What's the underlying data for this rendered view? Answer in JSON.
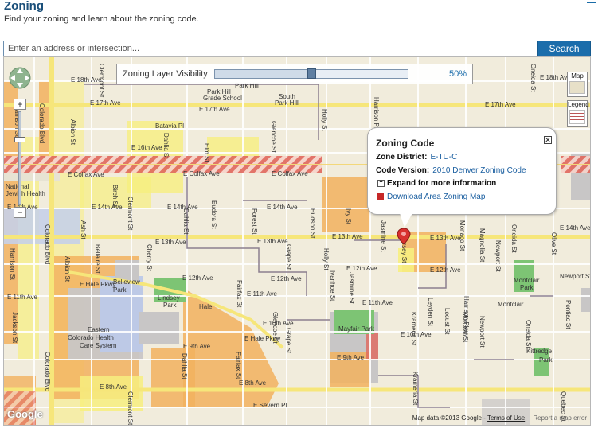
{
  "header": {
    "title": "Zoning",
    "subtitle": "Find your zoning and learn about the zoning code."
  },
  "search": {
    "placeholder": "Enter an address or intersection...",
    "button_label": "Search"
  },
  "layer_slider": {
    "label": "Zoning Layer Visibility",
    "value_label": "50%",
    "value": 0.5
  },
  "map_controls": {
    "map_type_label": "Map",
    "legend_label": "Legend"
  },
  "popup": {
    "title": "Zoning Code",
    "zone_district_label": "Zone District:",
    "zone_district_value": "E-TU-C",
    "code_version_label": "Code Version:",
    "code_version_value": "2010 Denver Zoning Code",
    "expand_label": "Expand for more information",
    "download_label": "Download Area Zoning Map"
  },
  "map_labels": {
    "streets": [
      "E 18th Ave",
      "E 17th Ave",
      "Batavia Pl",
      "E 16th Ave",
      "E Colfax Ave",
      "E 14th Ave",
      "E 13th Ave",
      "E 12th Ave",
      "E 11th Ave",
      "E Hale Pkwy",
      "E 10th Ave",
      "E 9th Ave",
      "E 8th Ave",
      "E Severn Pl",
      "Montclair",
      "Kittredge Park",
      "Mayfair Park",
      "Lindsey Park",
      "Belleview Park",
      "Montclair Park",
      "Hale",
      "Park Hill",
      "Park Hill Grade School",
      "South Park Hill",
      "Colorado Blvd",
      "Albion St",
      "Ash St",
      "Bellaire St",
      "Birch St",
      "Clermont St",
      "Cherry St",
      "Dahlia St",
      "Elm St",
      "Eudora St",
      "Fairfax St",
      "Forest St",
      "Glencoe St",
      "Grape St",
      "Holly St",
      "Hudson St",
      "Ivanhoe St",
      "Ivy St",
      "Jasmine St",
      "Jersey St",
      "Krameria St",
      "Kearney St",
      "Leyden St",
      "Locust St",
      "Magnolia St",
      "Monaco St",
      "Newport St",
      "Oneida St",
      "Olive St",
      "Pontiac St",
      "Harrison St",
      "Jackson St",
      "Harrison Pkwy",
      "Quebec St",
      "Eastern Colorado Health Care System",
      "National Jewish Health"
    ]
  },
  "attribution": {
    "map_data": "Map data ©2013 Google",
    "terms": "Terms of Use",
    "report": "Report a map error",
    "logo": "Google"
  },
  "colors": {
    "yellow_zone": "#f7ef7f",
    "orange_zone": "#f2b25e",
    "mixed_use_hatch": "#e0675c",
    "institutional": "#c8c6c6",
    "green_park": "#7dc474",
    "blue_campus": "#bcc9e8",
    "brand_blue": "#1b6dab"
  }
}
